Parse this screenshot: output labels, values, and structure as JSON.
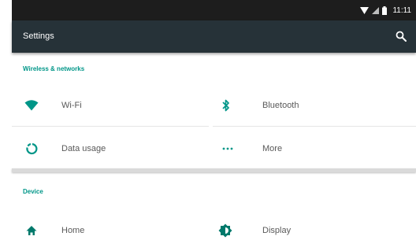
{
  "status_bar": {
    "time": "11:11"
  },
  "app_bar": {
    "title": "Settings"
  },
  "sections": [
    {
      "header": "Wireless & networks",
      "items": [
        {
          "label": "Wi-Fi",
          "icon": "wifi-icon"
        },
        {
          "label": "Bluetooth",
          "icon": "bluetooth-icon"
        },
        {
          "label": "Data usage",
          "icon": "data-usage-icon"
        },
        {
          "label": "More",
          "icon": "more-icon"
        }
      ]
    },
    {
      "header": "Device",
      "items": [
        {
          "label": "Home",
          "icon": "home-icon"
        },
        {
          "label": "Display",
          "icon": "display-brightness-icon"
        }
      ]
    }
  ],
  "colors": {
    "accent": "#009688",
    "app_bar": "#263238",
    "status_bar": "#1d1d1d"
  }
}
